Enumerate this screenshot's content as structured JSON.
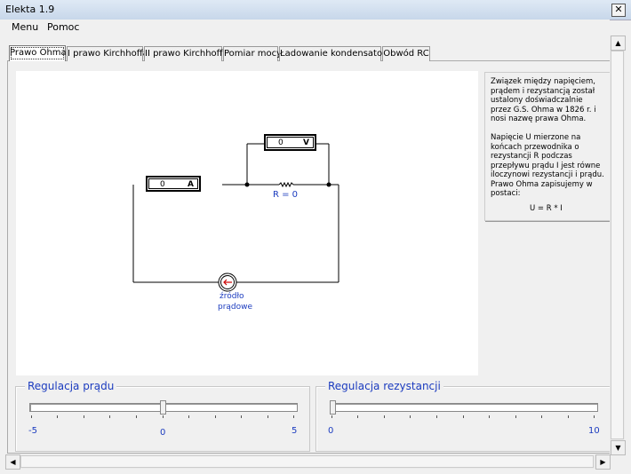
{
  "window": {
    "title": "Elekta 1.9",
    "close_label": "✕"
  },
  "menu": {
    "items": [
      "Menu",
      "Pomoc"
    ]
  },
  "tabs": [
    "Prawo Ohma",
    "I prawo Kirchhoffa",
    "II prawo Kirchhoffa",
    "Pomiar mocy",
    "Ładowanie kondensatora",
    "Obwód RC"
  ],
  "active_tab": "Prawo Ohma",
  "circuit": {
    "ammeter_value": "0",
    "ammeter_unit": "A",
    "voltmeter_value": "0",
    "voltmeter_unit": "V",
    "resistor_label": "R = 0",
    "source_label_line1": "źródło",
    "source_label_line2": "prądowe"
  },
  "info": {
    "para1": "Związek między napięciem, prądem i rezystancją został ustalony doświadczalnie przez G.S. Ohma w 1826 r. i nosi nazwę prawa Ohma.",
    "para2": "Napięcie U mierzone na końcach przewodnika o rezystancji R podczas przepływu prądu I jest równe iloczynowi rezystancji i prądu. Prawo Ohma zapisujemy w postaci:",
    "formula": "U = R * I"
  },
  "current_slider": {
    "title": "Regulacja prądu",
    "min_label": "-5",
    "mid_label": "0",
    "max_label": "5",
    "min": -5,
    "max": 5,
    "value": 0
  },
  "resistance_slider": {
    "title": "Regulacja rezystancji",
    "min_label": "0",
    "max_label": "10",
    "min": 0,
    "max": 10,
    "value": 0
  },
  "colors": {
    "label_blue": "#1c3cbf",
    "source_red": "#cc0000"
  }
}
